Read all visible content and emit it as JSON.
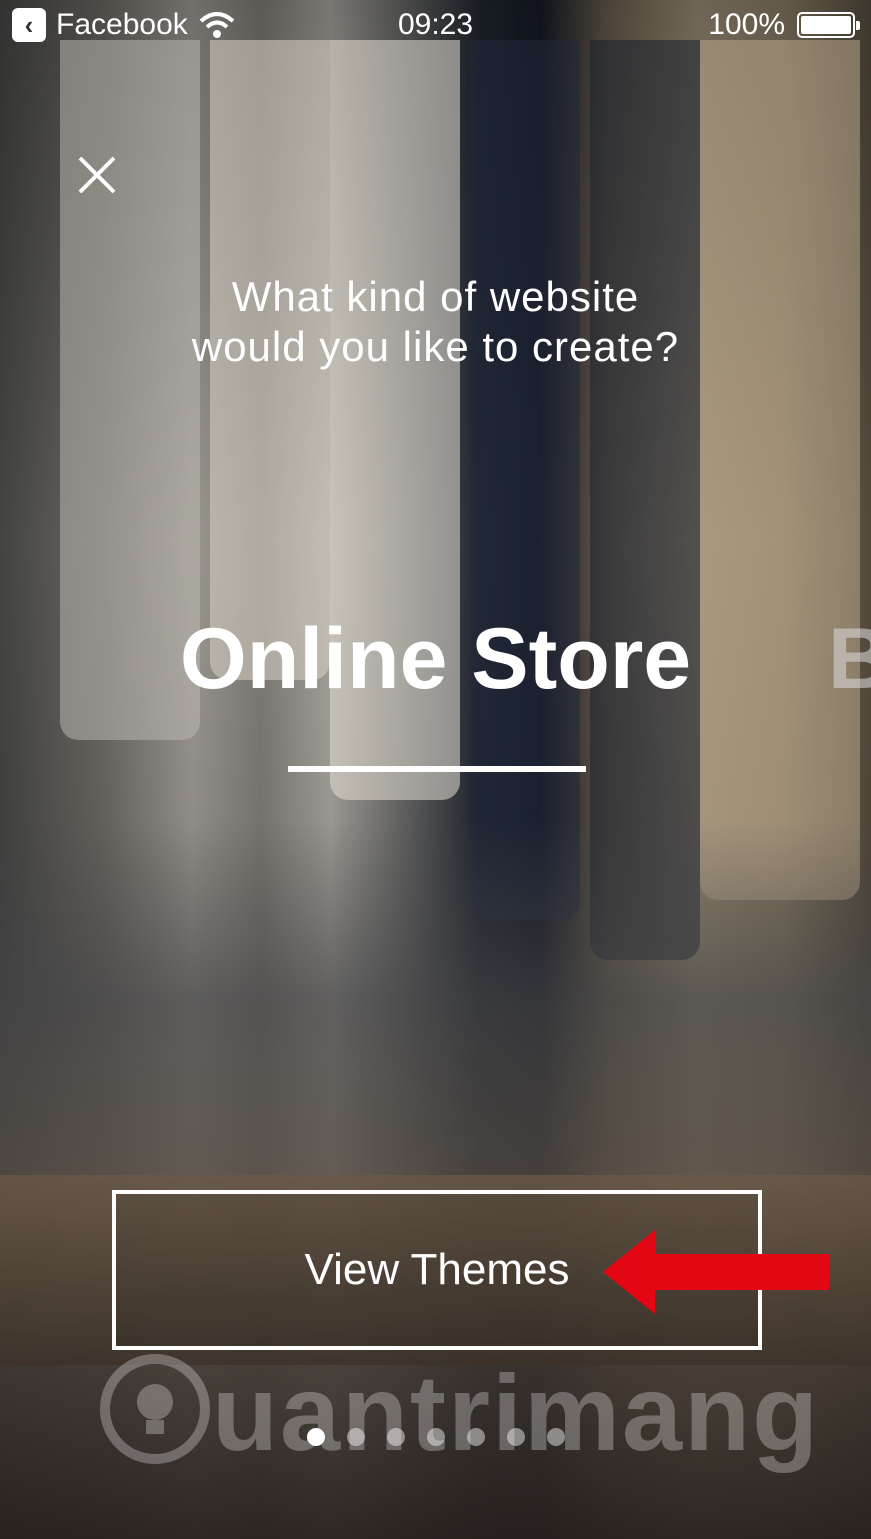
{
  "status_bar": {
    "back_app": "Facebook",
    "time": "09:23",
    "battery": "100%",
    "battery_level": 1.0
  },
  "dialog": {
    "question": "What kind of website would you like to create?",
    "category": "Online Store",
    "next_category_peek": "B",
    "view_button": "View Themes"
  },
  "pager": {
    "count": 7,
    "active_index": 0
  },
  "watermark": {
    "text": "uantrimang"
  },
  "colors": {
    "arrow": "#e30613",
    "text": "#ffffff"
  }
}
